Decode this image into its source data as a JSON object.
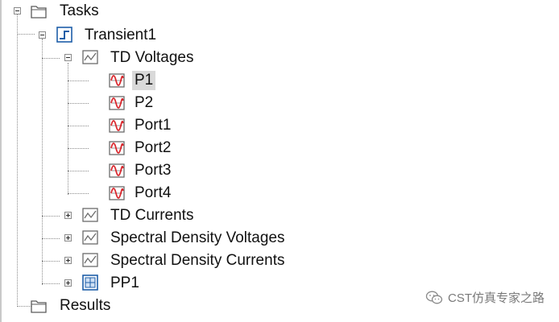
{
  "tree": {
    "tasks": {
      "label": "Tasks",
      "icon": "folder-icon"
    },
    "transient": {
      "label": "Transient1",
      "icon": "transient-step-icon"
    },
    "td_voltages": {
      "label": "TD Voltages",
      "icon": "graph-icon",
      "children": [
        "P1",
        "P2",
        "Port1",
        "Port2",
        "Port3",
        "Port4"
      ],
      "selected": "P1"
    },
    "td_currents": {
      "label": "TD Currents",
      "icon": "graph-icon"
    },
    "spectral_density_voltages": {
      "label": "Spectral Density Voltages",
      "icon": "graph-icon"
    },
    "spectral_density_currents": {
      "label": "Spectral Density Currents",
      "icon": "graph-icon"
    },
    "pp1": {
      "label": "PP1",
      "icon": "grid-icon"
    },
    "results": {
      "label": "Results",
      "icon": "folder-icon"
    }
  },
  "watermark": {
    "text": "CST仿真专家之路",
    "icon": "wechat-icon"
  },
  "colors": {
    "selection": "#d9d9d9",
    "graph_curve": "#d9262c",
    "step_icon": "#1e5ea8"
  }
}
